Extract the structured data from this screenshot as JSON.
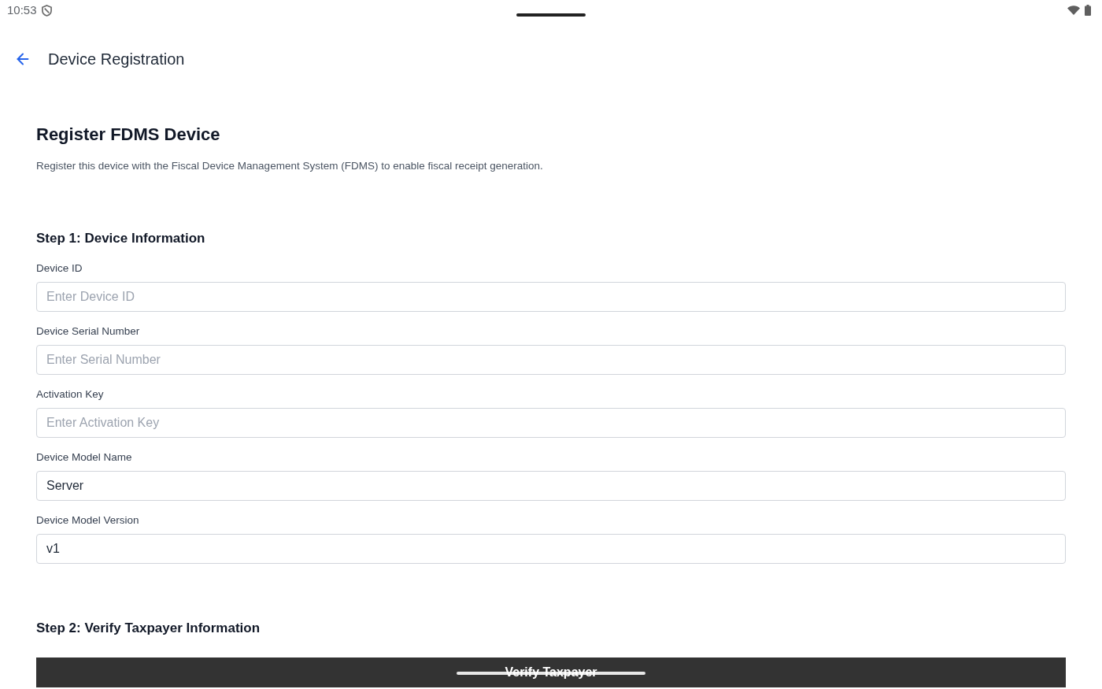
{
  "status_bar": {
    "time": "10:53"
  },
  "app_bar": {
    "title": "Device Registration"
  },
  "intro": {
    "title": "Register FDMS Device",
    "description": "Register this device with the Fiscal Device Management System (FDMS) to enable fiscal receipt generation."
  },
  "steps": [
    {
      "heading": "Step 1: Device Information",
      "fields": [
        {
          "label": "Device ID",
          "placeholder": "Enter Device ID"
        },
        {
          "label": "Device Serial Number",
          "placeholder": "Enter Serial Number"
        },
        {
          "label": "Activation Key",
          "placeholder": "Enter Activation Key"
        },
        {
          "label": "Device Model Name",
          "value": "Server"
        },
        {
          "label": "Device Model Version",
          "value": "v1"
        }
      ]
    },
    {
      "heading": "Step 2: Verify Taxpayer Information",
      "button": "Verify Taxpayer"
    }
  ]
}
